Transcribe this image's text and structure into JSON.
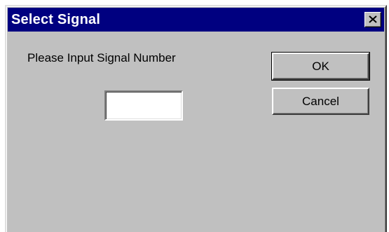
{
  "dialog": {
    "title": "Select Signal",
    "prompt": "Please Input Signal Number",
    "signal_input": {
      "value": "",
      "placeholder": ""
    },
    "buttons": {
      "ok_label": "OK",
      "cancel_label": "Cancel"
    },
    "icons": {
      "close": "close-icon"
    },
    "colors": {
      "titlebar": "#000080",
      "title_text": "#ffffff",
      "face": "#c0c0c0",
      "input_bg": "#ffffff"
    }
  }
}
